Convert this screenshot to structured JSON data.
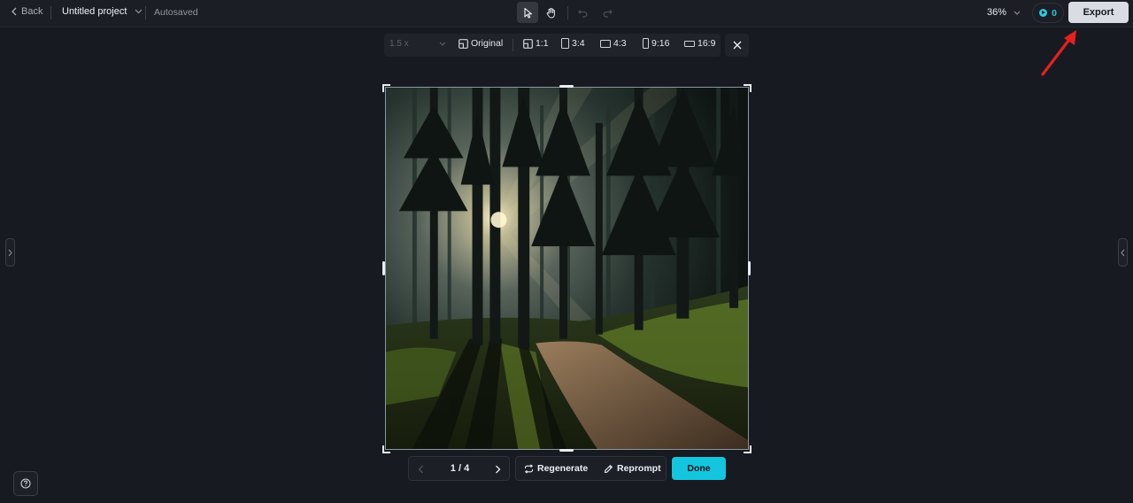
{
  "header": {
    "back_label": "Back",
    "project_title": "Untitled project",
    "save_status": "Autosaved",
    "zoom_level": "36%",
    "credits": "0",
    "export_label": "Export"
  },
  "aspect_toolbar": {
    "scale_value": "1.5 x",
    "options": [
      "Original",
      "1:1",
      "3:4",
      "4:3",
      "9:16",
      "16:9"
    ]
  },
  "canvas": {
    "image_description_icon": "forest-image"
  },
  "bottom_bar": {
    "page_indicator": "1 / 4",
    "regenerate_label": "Regenerate",
    "reprompt_label": "Reprompt",
    "done_label": "Done"
  },
  "colors": {
    "accent": "#13c6de",
    "background": "#171a21",
    "annotation_arrow": "#e5211f"
  }
}
